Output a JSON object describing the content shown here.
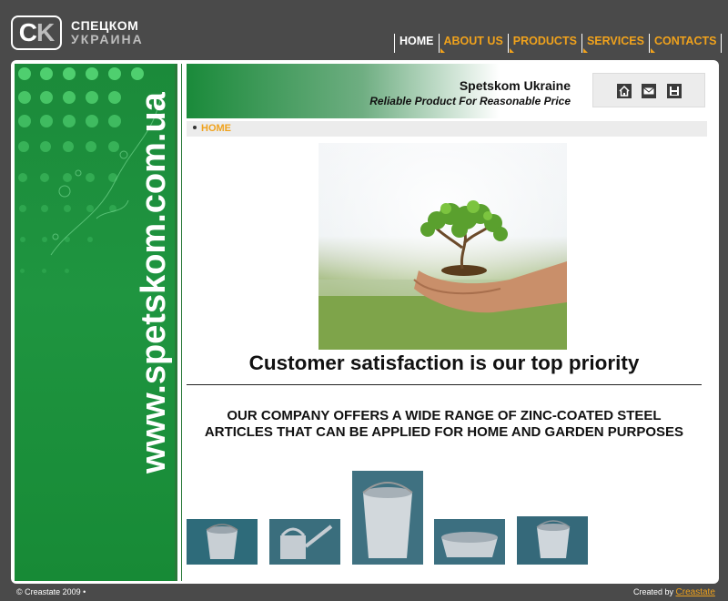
{
  "logo": {
    "letters_c": "C",
    "letters_k": "K",
    "line1": "СПЕЦКОМ",
    "line2": "УКРАИНА"
  },
  "nav": [
    {
      "label": "HOME",
      "active": true
    },
    {
      "label": "ABOUT US",
      "active": false
    },
    {
      "label": "PRODUCTS",
      "active": false
    },
    {
      "label": "SERVICES",
      "active": false
    },
    {
      "label": "CONTACTS",
      "active": false
    }
  ],
  "sidebar": {
    "vertical_text": "www.spetskom.com.ua"
  },
  "header": {
    "title": "Spetskom Ukraine",
    "subtitle": "Reliable Product For Reasonable Price"
  },
  "header_icons": [
    "home-icon",
    "mail-icon",
    "save-icon"
  ],
  "breadcrumb": {
    "current": "HOME"
  },
  "main": {
    "slogan": "Customer satisfaction is our top priority",
    "company_text": "OUR COMPANY OFFERS A WIDE RANGE OF ZINC-COATED STEEL ARTICLES THAT CAN BE APPLIED FOR HOME AND GARDEN PURPOSES"
  },
  "products": [
    "small-bucket",
    "watering-can",
    "large-pail",
    "oval-tub",
    "tapered-bucket"
  ],
  "footer": {
    "copyright": "© Creastate 2009 •",
    "created_by": "Created by",
    "creator_link": "Creastate"
  },
  "colors": {
    "accent": "#f0a21c",
    "green": "#1f9540",
    "background": "#4a4a4a"
  }
}
